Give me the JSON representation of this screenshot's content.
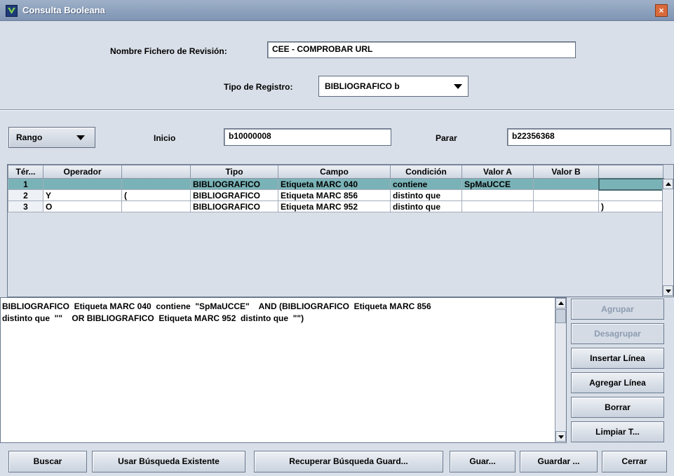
{
  "window": {
    "title": "Consulta Booleana",
    "close_label": "×"
  },
  "review": {
    "label": "Nombre Fichero de Revisión:",
    "value": "CEE - COMPROBAR URL"
  },
  "record_type": {
    "label": "Tipo de Registro:",
    "selected": "BIBLIOGRAFICO b"
  },
  "range": {
    "mode": "Rango",
    "start_label": "Inicio",
    "start_value": "b10000008",
    "stop_label": "Parar",
    "stop_value": "b22356368"
  },
  "table": {
    "headers": [
      "Tér...",
      "Operador",
      "",
      "Tipo",
      "Campo",
      "Condición",
      "Valor A",
      "Valor B",
      ""
    ],
    "rows": [
      [
        "1",
        "",
        "",
        "BIBLIOGRAFICO",
        "Etiqueta MARC 040",
        "contiene",
        "SpMaUCCE",
        "",
        ""
      ],
      [
        "2",
        "Y",
        "(",
        "BIBLIOGRAFICO",
        "Etiqueta MARC 856",
        "distinto que",
        "",
        "",
        ""
      ],
      [
        "3",
        "O",
        "",
        "BIBLIOGRAFICO",
        "Etiqueta MARC 952",
        "distinto que",
        "",
        "",
        ")"
      ]
    ]
  },
  "query": {
    "text": "BIBLIOGRAFICO  Etiqueta MARC 040  contiene  \"SpMaUCCE\"    AND (BIBLIOGRAFICO  Etiqueta MARC 856\ndistinto que  \"\"    OR BIBLIOGRAFICO  Etiqueta MARC 952  distinto que  \"\")"
  },
  "side_buttons": {
    "group": "Agrupar",
    "ungroup": "Desagrupar",
    "insert_line": "Insertar Línea",
    "add_line": "Agregar Línea",
    "delete": "Borrar",
    "clear": "Limpiar T..."
  },
  "bottom_buttons": {
    "search": "Buscar",
    "use_existing": "Usar Búsqueda Existente",
    "retrieve_saved": "Recuperar Búsqueda Guard...",
    "save_short": "Guar...",
    "save_as": "Guardar ...",
    "close": "Cerrar"
  }
}
